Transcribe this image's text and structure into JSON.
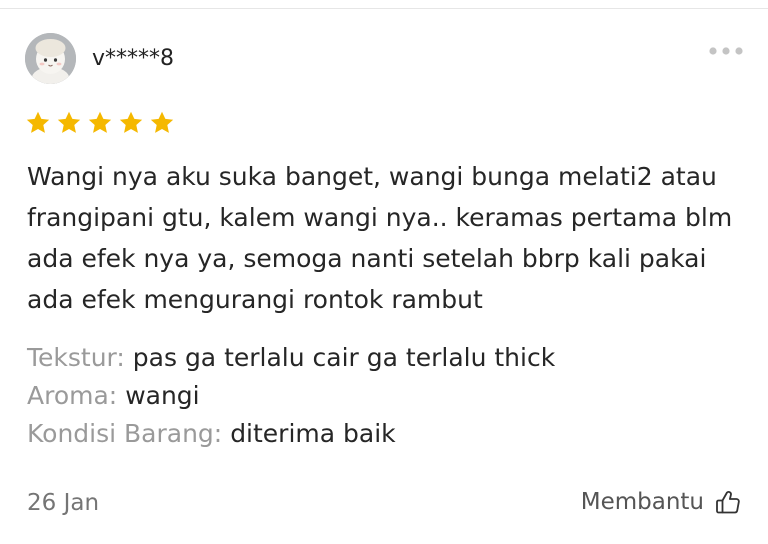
{
  "review": {
    "username": "v*****8",
    "rating": 5,
    "max_rating": 5,
    "text": "Wangi nya aku suka banget, wangi bunga melati2 atau frangipani gtu, kalem wangi nya.. keramas pertama blm ada efek nya ya, semoga nanti setelah bbrp kali pakai ada efek mengurangi rontok rambut",
    "attributes": [
      {
        "label": "Tekstur:",
        "value": "pas ga terlalu cair ga terlalu thick"
      },
      {
        "label": "Aroma:",
        "value": "wangi"
      },
      {
        "label": "Kondisi Barang:",
        "value": "diterima baik"
      }
    ],
    "date": "26 Jan",
    "helpful_label": "Membantu"
  },
  "icons": {
    "more": "more-horizontal-icon",
    "star": "star-icon",
    "helpful": "thumbs-up-icon"
  },
  "colors": {
    "star": "#F5B800",
    "label_gray": "#9A9A9A",
    "text": "#262626",
    "muted": "#757575"
  }
}
